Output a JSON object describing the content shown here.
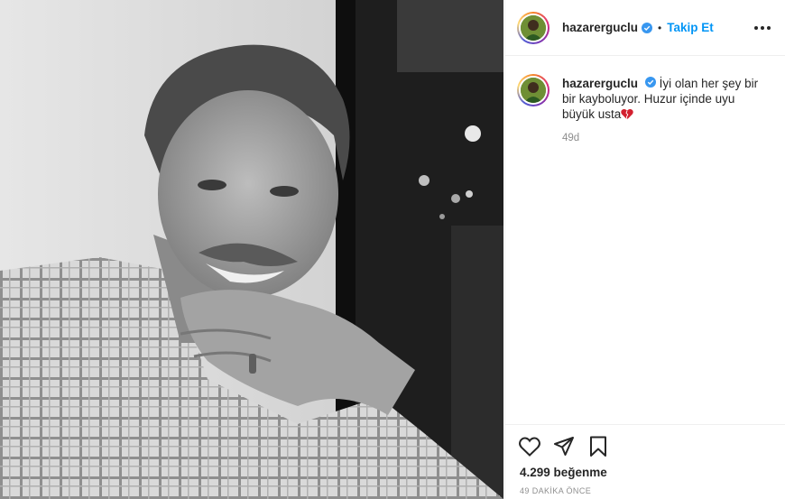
{
  "post": {
    "username": "hazarerguclu",
    "follow_label": "Takip Et",
    "separator": "•",
    "caption_text": "İyi olan her şey bir bir kayboluyor. Huzur içinde uyu büyük usta",
    "caption_emoji": "broken-heart-icon",
    "time_short": "49d",
    "likes_text": "4.299 beğenme",
    "time_ago": "49 DAKİKA ÖNCE"
  },
  "icons": {
    "verified": "verified-badge-icon",
    "more": "more-options-icon",
    "like": "heart-icon",
    "share": "share-icon",
    "save": "bookmark-icon"
  },
  "colors": {
    "accent": "#0095f6",
    "verified": "#3897f0",
    "text": "#262626",
    "muted": "#8e8e8e",
    "heart_emoji": "#d3202f"
  }
}
